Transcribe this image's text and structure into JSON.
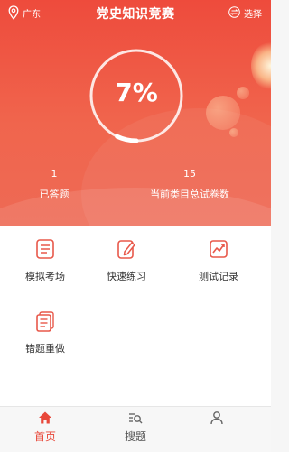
{
  "topbar": {
    "location": "广东",
    "title": "党史知识竞赛",
    "select_label": "选择"
  },
  "progress": {
    "percent_text": "7%",
    "value": 0.07
  },
  "stats": [
    {
      "value": "1",
      "label": "已答题"
    },
    {
      "value": "15",
      "label": "当前类目总试卷数"
    }
  ],
  "menu": [
    {
      "label": "模拟考场",
      "icon": "exam-sheet-icon"
    },
    {
      "label": "快速练习",
      "icon": "edit-pen-icon"
    },
    {
      "label": "测试记录",
      "icon": "chart-trend-icon"
    },
    {
      "label": "错题重做",
      "icon": "error-note-icon"
    }
  ],
  "tabs": [
    {
      "label": "首页",
      "icon": "home-icon",
      "active": true
    },
    {
      "label": "搜题",
      "icon": "search-list-icon",
      "active": false
    },
    {
      "label": "",
      "icon": "user-icon",
      "active": false
    }
  ],
  "colors": {
    "primary": "#ee4b3c",
    "menu_icon": "#e8584a",
    "tab_active": "#e8483a"
  }
}
